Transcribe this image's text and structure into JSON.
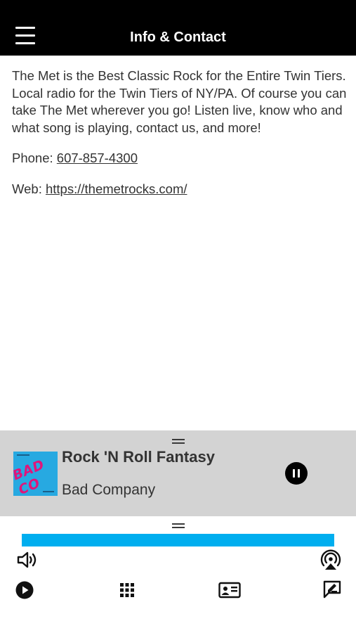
{
  "header": {
    "title": "Info & Contact",
    "menu_icon": "hamburger-menu-icon"
  },
  "info": {
    "description": "The Met is the Best Classic Rock for the Entire Twin Tiers. Local radio for the Twin Tiers of NY/PA. Of course you can take The Met wherever you go! Listen live, know who and what song is playing, contact us, and more!",
    "phone_label": "Phone: ",
    "phone_number": "607-857-4300",
    "web_label": "Web: ",
    "web_url": "https://themetrocks.com/"
  },
  "now_playing": {
    "track_title": "Rock 'N Roll Fantasy",
    "artist": "Bad Company",
    "album_art_text": "BAD CO",
    "playback_state": "playing",
    "pause_icon": "pause-icon"
  },
  "player": {
    "progress_fraction": 1.0,
    "progress_color": "#00aeef",
    "icons": [
      "volume-icon",
      "airplay-icon",
      "play-icon",
      "grid-icon",
      "contact-card-icon",
      "feedback-icon"
    ]
  },
  "colors": {
    "header_bg": "#000000",
    "now_playing_bg": "#d3d3d3",
    "accent": "#00aeef"
  }
}
